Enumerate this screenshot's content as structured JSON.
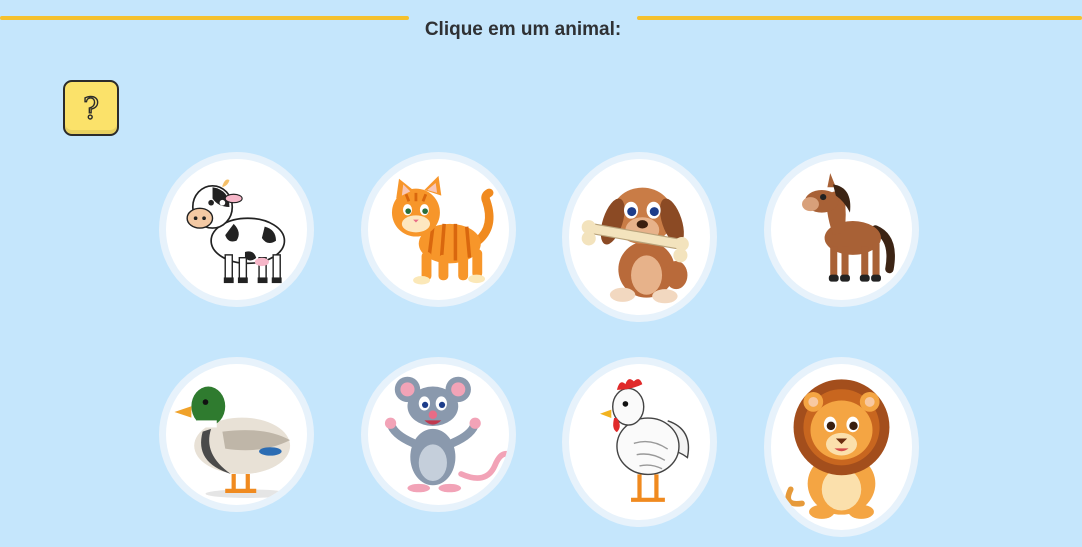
{
  "header": {
    "title": "Clique em um animal:"
  },
  "help_button": {
    "icon": "question-icon"
  },
  "animals": [
    {
      "name": "vaca",
      "icon": "cow-icon"
    },
    {
      "name": "gato",
      "icon": "cat-icon"
    },
    {
      "name": "cachorro",
      "icon": "dog-icon"
    },
    {
      "name": "cavalo",
      "icon": "horse-icon"
    },
    {
      "name": "pato",
      "icon": "duck-icon"
    },
    {
      "name": "rato",
      "icon": "mouse-icon"
    },
    {
      "name": "galinha",
      "icon": "chicken-icon"
    },
    {
      "name": "leão",
      "icon": "lion-icon"
    }
  ],
  "colors": {
    "background": "#c5e6fc",
    "rule": "#f5c12e",
    "help_button": "#fbe26a",
    "card_border": "#e7f2fb"
  }
}
